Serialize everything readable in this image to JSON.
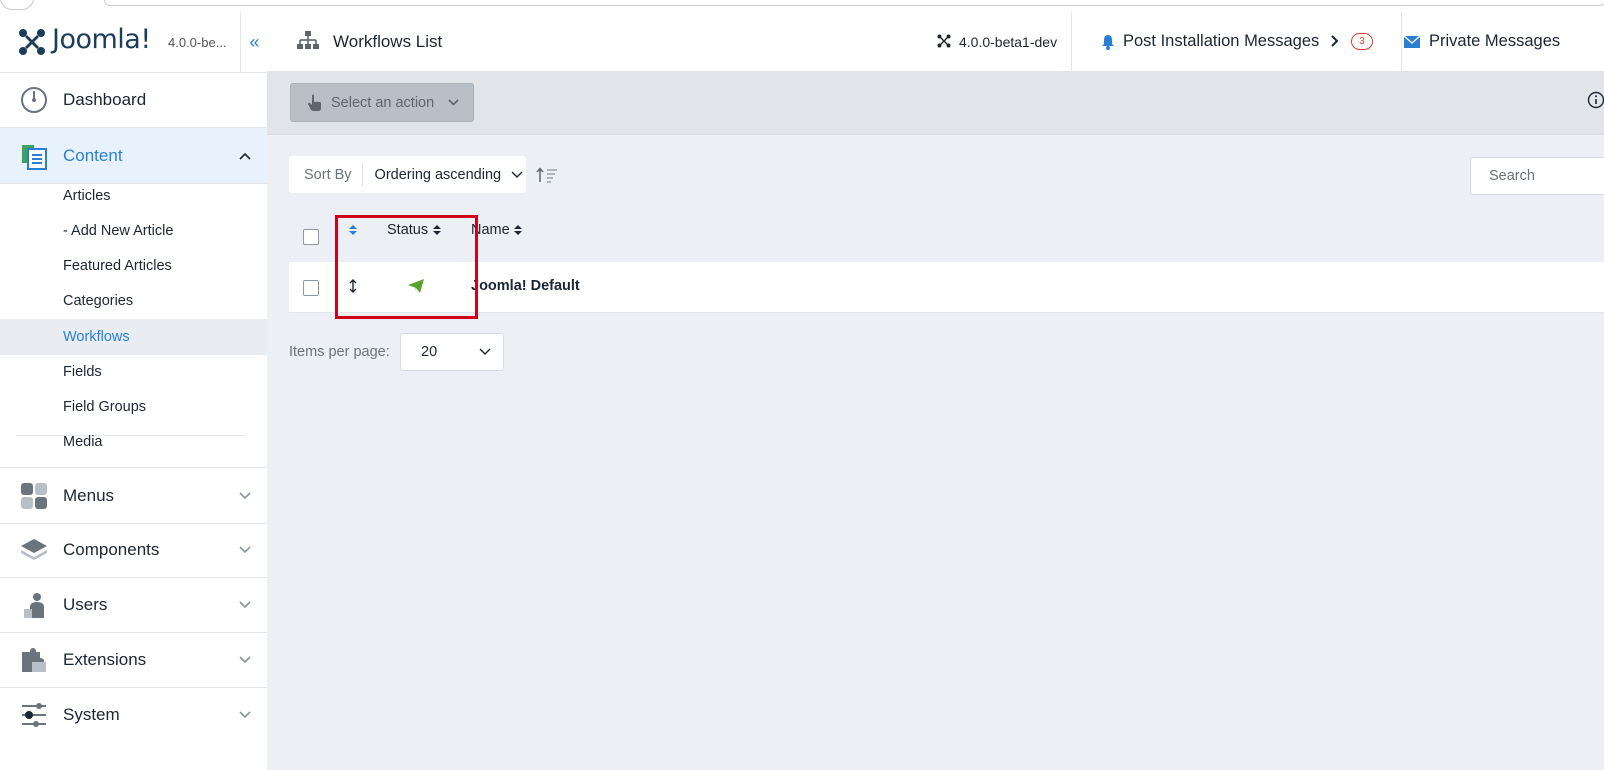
{
  "sidebar": {
    "brand_name": "Joomla!",
    "version_short": "4.0.0-be...",
    "collapse_glyph": "«",
    "items": [
      {
        "label": "Dashboard",
        "icon": "dashboard-icon"
      },
      {
        "label": "Content",
        "icon": "content-icon",
        "expanded": true
      },
      {
        "label": "Menus",
        "icon": "menus-icon"
      },
      {
        "label": "Components",
        "icon": "components-icon"
      },
      {
        "label": "Users",
        "icon": "users-icon"
      },
      {
        "label": "Extensions",
        "icon": "extensions-icon"
      },
      {
        "label": "System",
        "icon": "system-icon"
      }
    ],
    "content_sub": [
      {
        "label": "Articles"
      },
      {
        "label": "-  Add New Article"
      },
      {
        "label": "Featured Articles"
      },
      {
        "label": "Categories"
      },
      {
        "label": "Workflows",
        "active": true
      },
      {
        "label": "Fields"
      },
      {
        "label": "Field Groups"
      },
      {
        "label": "Media"
      }
    ]
  },
  "header": {
    "title": "Workflows List",
    "version": "4.0.0-beta1-dev",
    "post_install": "Post Installation Messages",
    "post_install_count": "3",
    "private_messages": "Private Messages"
  },
  "toolbar": {
    "action_label": "Select an action"
  },
  "filters": {
    "sort_label": "Sort By",
    "sort_value": "Ordering ascending",
    "search_placeholder": "Search"
  },
  "table": {
    "headers": {
      "status": "Status",
      "name": "Name"
    },
    "rows": [
      {
        "name": "Joomla! Default",
        "status": "published"
      }
    ]
  },
  "pagination": {
    "items_per_page_label": "Items per page:",
    "items_per_page_value": "20"
  },
  "colors": {
    "accent": "#2a7fd4",
    "published": "#5aa52b",
    "highlight": "#d0021b",
    "badge": "#d9432d"
  }
}
